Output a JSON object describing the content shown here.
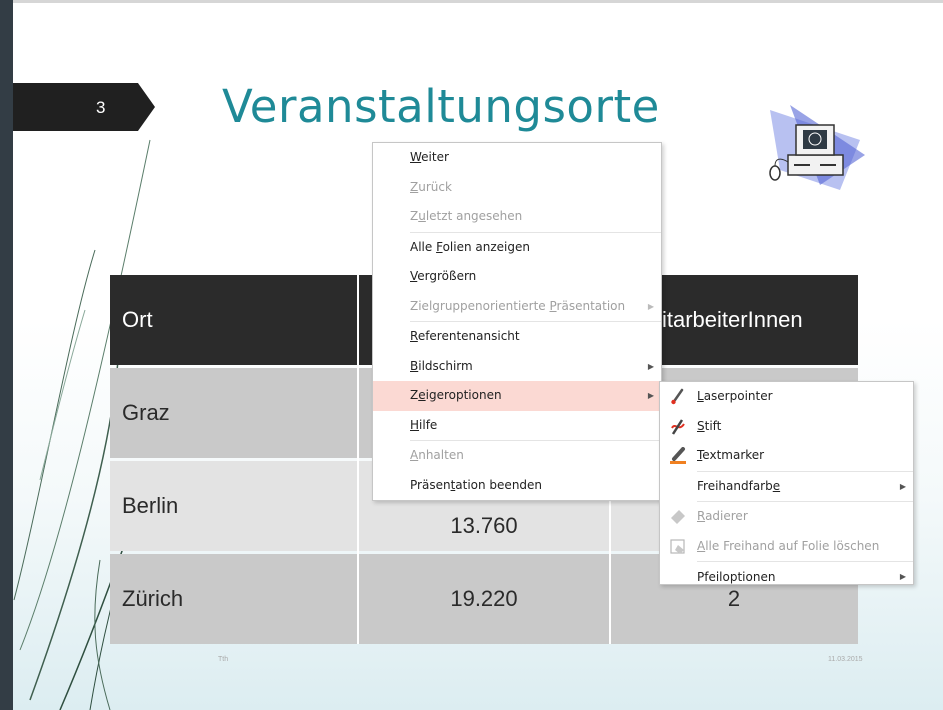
{
  "slide": {
    "number": "3",
    "title": "Veranstaltungsorte",
    "footer_left": "Tth",
    "footer_right": "11.03.2015"
  },
  "table": {
    "header": {
      "col1": "Ort",
      "col3_partial": "itarbeiterInnen"
    },
    "rows": [
      {
        "ort": "Graz",
        "value": "",
        "count": ""
      },
      {
        "ort": "Berlin",
        "value": "13.760",
        "count": ""
      },
      {
        "ort": "Zürich",
        "value": "19.220",
        "count": "2"
      }
    ]
  },
  "context_menu": {
    "items": [
      {
        "pre": "",
        "key": "W",
        "post": "eiter",
        "disabled": false
      },
      {
        "pre": "",
        "key": "Z",
        "post": "urück",
        "disabled": true
      },
      {
        "pre": "Z",
        "key": "u",
        "post": "letzt angesehen",
        "disabled": true
      },
      {
        "pre": "Alle ",
        "key": "F",
        "post": "olien anzeigen",
        "disabled": false
      },
      {
        "pre": "",
        "key": "V",
        "post": "ergrößern",
        "disabled": false
      },
      {
        "pre": "Zielgruppenorientierte ",
        "key": "P",
        "post": "räsentation",
        "disabled": true,
        "submenu": true
      },
      {
        "pre": "",
        "key": "R",
        "post": "eferentenansicht",
        "disabled": false
      },
      {
        "pre": "",
        "key": "B",
        "post": "ildschirm",
        "disabled": false,
        "submenu": true
      },
      {
        "pre": "Z",
        "key": "e",
        "post": "igeroptionen",
        "disabled": false,
        "submenu": true,
        "selected": true
      },
      {
        "pre": "",
        "key": "H",
        "post": "ilfe",
        "disabled": false
      },
      {
        "pre": "",
        "key": "A",
        "post": "nhalten",
        "disabled": true
      },
      {
        "pre": "Präsen",
        "key": "t",
        "post": "ation beenden",
        "disabled": false
      }
    ],
    "submenu_arrow": "▶"
  },
  "pointer_submenu": {
    "items": [
      {
        "pre": "",
        "key": "L",
        "post": "aserpointer",
        "icon": "laser-pointer-icon",
        "disabled": false
      },
      {
        "pre": "",
        "key": "S",
        "post": "tift",
        "icon": "pen-icon",
        "disabled": false
      },
      {
        "pre": "",
        "key": "T",
        "post": "extmarker",
        "icon": "highlighter-icon",
        "disabled": false
      },
      {
        "pre": "Freihandfarb",
        "key": "e",
        "post": "",
        "icon": "",
        "disabled": false,
        "submenu": true
      },
      {
        "pre": "",
        "key": "R",
        "post": "adierer",
        "icon": "eraser-icon",
        "disabled": true
      },
      {
        "pre": "",
        "key": "A",
        "post": "lle Freihand auf Folie löschen",
        "icon": "erase-all-icon",
        "disabled": true
      },
      {
        "pre": "Pfeiloptionen",
        "key": "",
        "post": "",
        "icon": "",
        "disabled": false,
        "submenu": true
      }
    ]
  },
  "colors": {
    "title": "#1f8a97",
    "menu_highlight": "#fbd9d3",
    "table_header": "#2b2b2b",
    "slide_bar": "#333d45"
  }
}
